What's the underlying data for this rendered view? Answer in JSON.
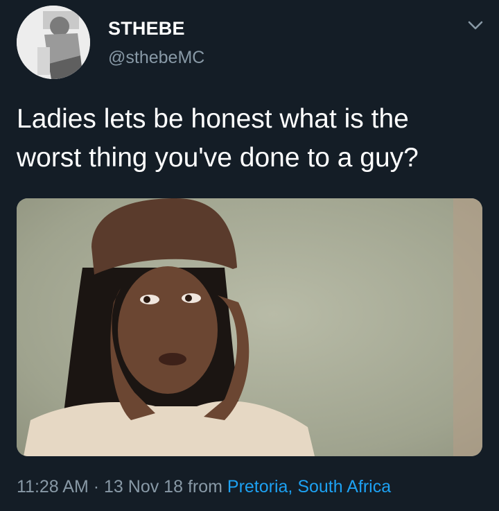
{
  "tweet": {
    "display_name": "STHEBE",
    "handle": "@sthebeMC",
    "text": "Ladies lets be honest what is the\nworst thing you've done to a guy?",
    "time": "11:28 AM",
    "separator": "·",
    "date": "13 Nov 18",
    "from_label": "from",
    "location": "Pretoria, South Africa"
  },
  "icons": {
    "menu": "chevron-down-icon",
    "avatar": "avatar"
  },
  "colors": {
    "background": "#141d26",
    "text": "#ffffff",
    "secondary": "#8899a6",
    "link": "#1da1f2"
  }
}
